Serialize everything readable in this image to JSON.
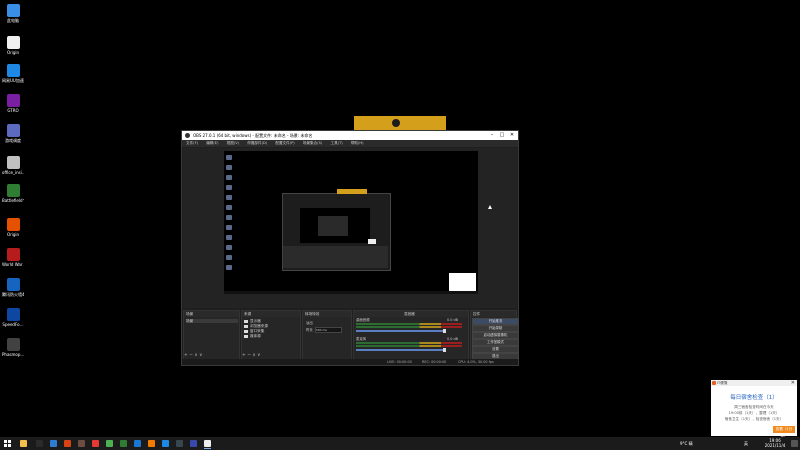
{
  "desktop": {
    "icons": [
      {
        "label": "此电脑",
        "color": "#3a8ee6"
      },
      {
        "label": "Origin",
        "color": "#f0f0f0"
      },
      {
        "label": "网易UU加速器",
        "color": "#1e88e5"
      },
      {
        "label": "GTRO",
        "color": "#7b1fa2"
      },
      {
        "label": "游戏调度",
        "color": "#5c6bc0"
      },
      {
        "label": "office_insi…",
        "color": "#c0c0c0"
      },
      {
        "label": "Battlefield™ 2042 Ope…",
        "color": "#2e7d32"
      },
      {
        "label": "Origin",
        "color": "#e65100"
      },
      {
        "label": "World War Z Aftermath",
        "color": "#b71c1c"
      },
      {
        "label": "腾讯防火墙4.0",
        "color": "#1565c0"
      },
      {
        "label": "SpeedFo…",
        "color": "#0d47a1"
      },
      {
        "label": "Phasmop…",
        "color": "#424242"
      }
    ]
  },
  "obs": {
    "title": "OBS 27.0.1 (64 bit, windows) - 配置文件: 未命名 - 场景: 未命名",
    "controls": {
      "minimize": "–",
      "maximize": "□",
      "close": "✕"
    },
    "menu": [
      "文件(F)",
      "编辑(E)",
      "视图(V)",
      "停靠部件(D)",
      "配置文件(P)",
      "场景集合(S)",
      "工具(T)",
      "帮助(H)"
    ],
    "docks": {
      "scenes": {
        "title": "场景",
        "items": [
          "场景"
        ]
      },
      "sources": {
        "title": "来源",
        "items": [
          "显示器",
          "浏览器来源",
          "窗口采集",
          "媒体源"
        ],
        "header_tools": "属性   滤镜"
      },
      "mixer": {
        "title": "混音器",
        "tracks": [
          {
            "name": "桌面音频",
            "db": "0.0 dB"
          },
          {
            "name": "麦克风",
            "db": "0.0 dB"
          }
        ]
      },
      "transitions": {
        "title": "转场特效",
        "fade_label": "淡出",
        "duration_label": "时长",
        "duration_value": "300 ms"
      },
      "controls": {
        "title": "控件",
        "buttons": [
          "开始推流",
          "开始录制",
          "启动虚拟摄像机",
          "工作室模式",
          "设置",
          "退出"
        ]
      }
    },
    "footer_controls": "+ − ∧ ∨",
    "status": {
      "live": "LIVE: 00:00:00",
      "rec": "REC: 00:00:00",
      "cpu": "CPU: 4.0%, 30.00 fps"
    }
  },
  "notification": {
    "app": "IT便笺",
    "title": "每日宿舍检查（1）",
    "lines": [
      "周三宿舍检查时间在今天",
      "19:00前（1天），整理（1天）",
      "宿舍卫生（1天），检查宿舍（1天）"
    ],
    "button": "查看（1分钟）",
    "close": "✕"
  },
  "taskbar": {
    "apps": [
      {
        "name": "file-explorer-icon",
        "color": "#f3c14b"
      },
      {
        "name": "terminal-icon",
        "color": "#2b2b2b"
      },
      {
        "name": "ie-icon",
        "color": "#2e7dd2"
      },
      {
        "name": "mail-icon",
        "color": "#d84315"
      },
      {
        "name": "store-icon",
        "color": "#6d4c41"
      },
      {
        "name": "netease-icon",
        "color": "#e53935"
      },
      {
        "name": "chrome-icon",
        "color": "#4caf50"
      },
      {
        "name": "wechat-icon",
        "color": "#2e7d32"
      },
      {
        "name": "qq-icon",
        "color": "#1976d2"
      },
      {
        "name": "orange-icon",
        "color": "#f57c00"
      },
      {
        "name": "vscode-icon",
        "color": "#1e88e5"
      },
      {
        "name": "steam-icon",
        "color": "#37474f"
      },
      {
        "name": "blue-app-icon",
        "color": "#3949ab"
      },
      {
        "name": "obs-icon",
        "color": "#eeeeee"
      }
    ],
    "weather": "9°C 晴",
    "tray_text": "英",
    "clock_time": "19:06",
    "clock_date": "2021/11/4"
  }
}
